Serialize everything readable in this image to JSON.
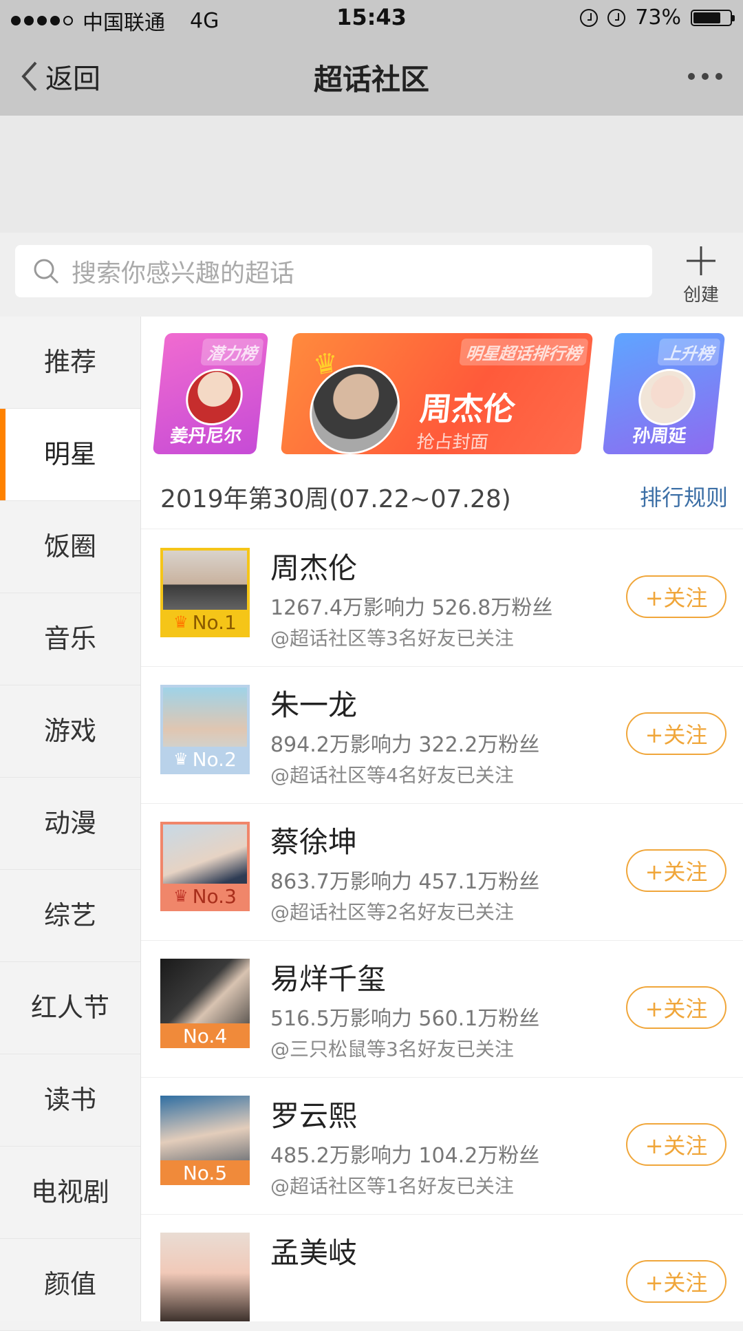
{
  "status_bar": {
    "carrier": "中国联通",
    "network": "4G",
    "time": "15:43",
    "battery": "73%"
  },
  "nav": {
    "back_label": "返回",
    "title": "超话社区"
  },
  "search": {
    "placeholder": "搜索你感兴趣的超话",
    "create_label": "创建"
  },
  "sidebar": {
    "items": [
      {
        "label": "推荐"
      },
      {
        "label": "明星"
      },
      {
        "label": "饭圈"
      },
      {
        "label": "音乐"
      },
      {
        "label": "游戏"
      },
      {
        "label": "动漫"
      },
      {
        "label": "综艺"
      },
      {
        "label": "红人节"
      },
      {
        "label": "读书"
      },
      {
        "label": "电视剧"
      },
      {
        "label": "颜值"
      }
    ],
    "active": "明星"
  },
  "banners": {
    "left": {
      "tag": "潜力榜",
      "name": "姜丹尼尔"
    },
    "center": {
      "tag": "明星超话排行榜",
      "name": "周杰伦",
      "sub": "抢占封面"
    },
    "right": {
      "tag": "上升榜",
      "name": "孙周延"
    }
  },
  "week": {
    "label": "2019年第30周(07.22~07.28)",
    "rules": "排行规则"
  },
  "rankings": [
    {
      "rank": "No.1",
      "name": "周杰伦",
      "stats": "1267.4万影响力 526.8万粉丝",
      "friends": "@超话社区等3名好友已关注",
      "follow": "+关注",
      "rank_color": "#f5c518"
    },
    {
      "rank": "No.2",
      "name": "朱一龙",
      "stats": "894.2万影响力 322.2万粉丝",
      "friends": "@超话社区等4名好友已关注",
      "follow": "+关注",
      "rank_color": "#b9d2ea"
    },
    {
      "rank": "No.3",
      "name": "蔡徐坤",
      "stats": "863.7万影响力 457.1万粉丝",
      "friends": "@超话社区等2名好友已关注",
      "follow": "+关注",
      "rank_color": "#f0866a"
    },
    {
      "rank": "No.4",
      "name": "易烊千玺",
      "stats": "516.5万影响力 560.1万粉丝",
      "friends": "@三只松鼠等3名好友已关注",
      "follow": "+关注",
      "rank_color": "#f08a3a"
    },
    {
      "rank": "No.5",
      "name": "罗云熙",
      "stats": "485.2万影响力 104.2万粉丝",
      "friends": "@超话社区等1名好友已关注",
      "follow": "+关注",
      "rank_color": "#f08a3a"
    },
    {
      "rank": "",
      "name": "孟美岐",
      "stats": "",
      "friends": "",
      "follow": "+关注",
      "rank_color": "#f08a3a"
    }
  ]
}
